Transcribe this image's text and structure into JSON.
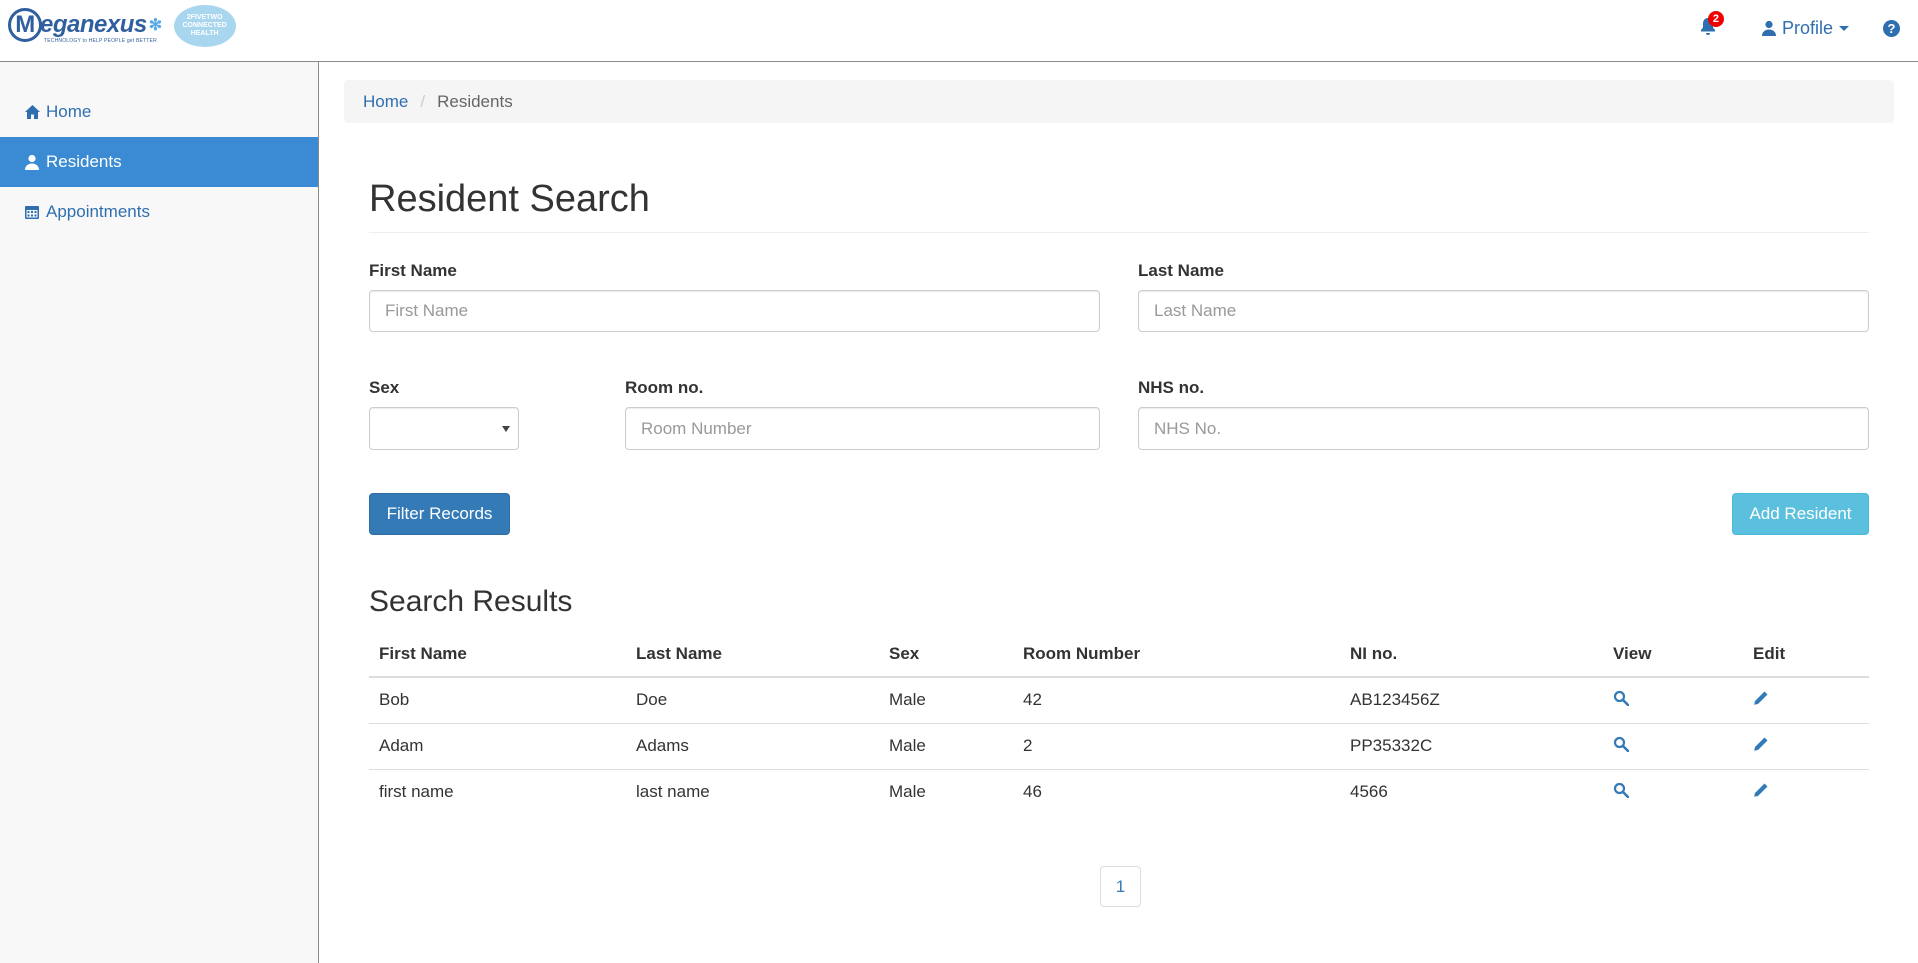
{
  "brand": {
    "name": "eganexus",
    "initial": "M",
    "tagline": "TECHNOLOGY to HELP PEOPLE get BETTER",
    "partner_line1": "2FIVETWO",
    "partner_line2": "CONNECTED",
    "partner_line3": "HEALTH"
  },
  "header": {
    "notifications_count": "2",
    "profile_label": "Profile",
    "help_label": "?"
  },
  "sidebar": {
    "items": [
      {
        "label": "Home",
        "icon": "home-icon",
        "active": false
      },
      {
        "label": "Residents",
        "icon": "user-icon",
        "active": true
      },
      {
        "label": "Appointments",
        "icon": "calendar-icon",
        "active": false
      }
    ]
  },
  "breadcrumb": {
    "home": "Home",
    "current": "Residents"
  },
  "search": {
    "title": "Resident Search",
    "first_name_label": "First Name",
    "first_name_placeholder": "First Name",
    "last_name_label": "Last Name",
    "last_name_placeholder": "Last Name",
    "sex_label": "Sex",
    "sex_value": "",
    "room_label": "Room no.",
    "room_placeholder": "Room Number",
    "nhs_label": "NHS no.",
    "nhs_placeholder": "NHS No.",
    "filter_button": "Filter Records",
    "add_button": "Add Resident"
  },
  "results": {
    "title": "Search Results",
    "columns": [
      "First Name",
      "Last Name",
      "Sex",
      "Room Number",
      "NI no.",
      "View",
      "Edit"
    ],
    "rows": [
      {
        "first": "Bob",
        "last": "Doe",
        "sex": "Male",
        "room": "42",
        "ni": "AB123456Z"
      },
      {
        "first": "Adam",
        "last": "Adams",
        "sex": "Male",
        "room": "2",
        "ni": "PP35332C"
      },
      {
        "first": "first name",
        "last": "last name",
        "sex": "Male",
        "room": "46",
        "ni": "4566"
      }
    ]
  },
  "pagination": {
    "current_page": "1"
  },
  "colors": {
    "primary": "#337ab7",
    "info": "#5bc0de",
    "sidebar_active": "#3a8bd3",
    "link": "#2f6fb0",
    "badge": "#ee0000"
  }
}
